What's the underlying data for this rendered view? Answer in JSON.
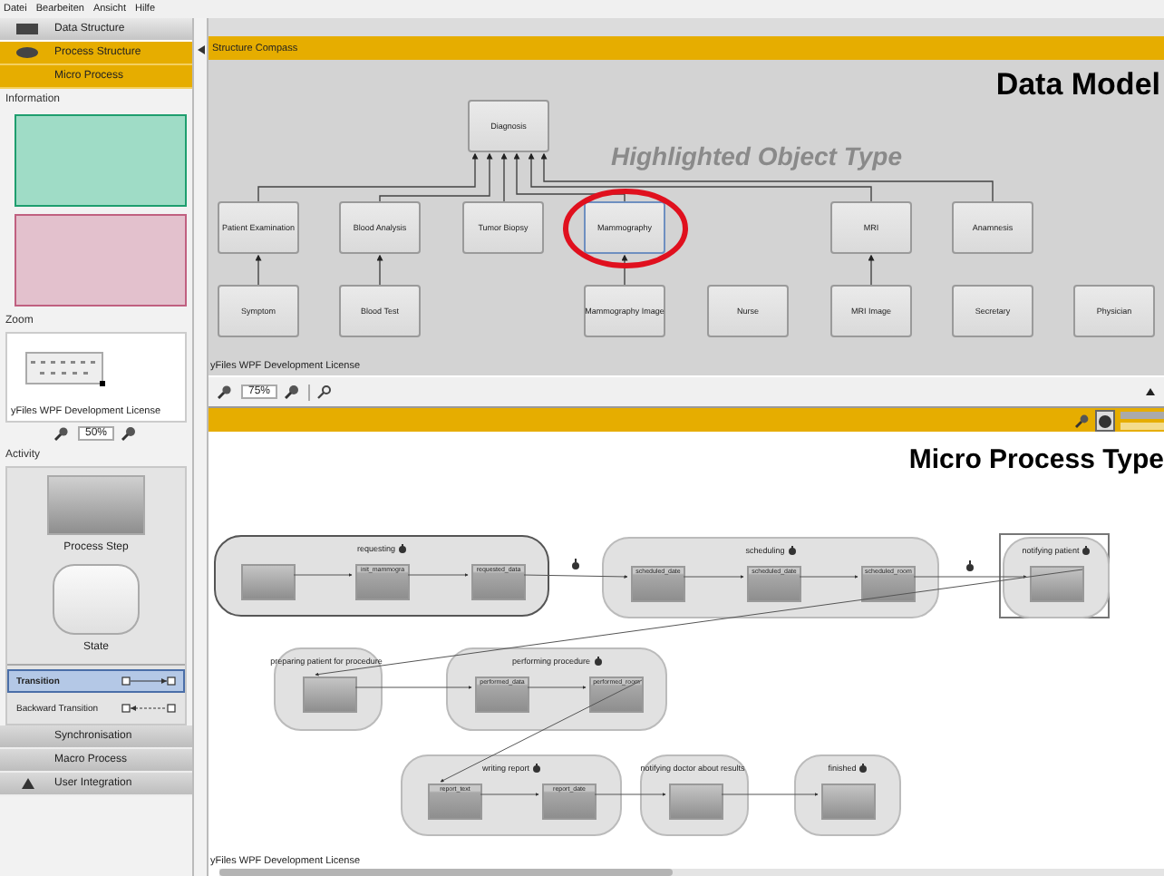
{
  "menu": [
    "Datei",
    "Bearbeiten",
    "Ansicht",
    "Hilfe"
  ],
  "navigation": [
    {
      "label": "Data Structure",
      "selected": false
    },
    {
      "label": "Process Structure",
      "selected": true
    },
    {
      "label": "Micro Process",
      "selected": true
    }
  ],
  "information": {
    "title": "Information",
    "cards": [
      {
        "color": "#9fdcc6"
      },
      {
        "color": "#e3c1cd"
      }
    ]
  },
  "zoom": {
    "title": "Zoom",
    "license": "yFiles WPF Development License",
    "value": "50%"
  },
  "activity": {
    "title": "Activity",
    "shapes": [
      {
        "kind": "process_step",
        "label": "Process Step"
      },
      {
        "kind": "state",
        "label": "State"
      }
    ],
    "transitions": [
      {
        "label": "Transition",
        "selected": true,
        "kind": "solid"
      },
      {
        "label": "Backward Transition",
        "selected": false,
        "kind": "dashed"
      }
    ]
  },
  "sections": [
    {
      "label": "Synchronisation"
    },
    {
      "label": "Macro Process"
    },
    {
      "label": "User Integration"
    }
  ],
  "structure_compass": {
    "title": "Structure Compass",
    "overlay_title": "Data Model",
    "annotation": "Highlighted Object Type",
    "license": "yFiles WPF Development License",
    "zoom_value": "75%",
    "root": {
      "label": "Diagnosis",
      "highlighted": false,
      "children": [
        {
          "label": "Patient Examination",
          "highlighted": false,
          "children": [
            {
              "label": "Symptom",
              "highlighted": false
            }
          ]
        },
        {
          "label": "Blood Analysis",
          "highlighted": false,
          "children": [
            {
              "label": "Blood Test",
              "highlighted": false
            }
          ]
        },
        {
          "label": "Tumor Biopsy",
          "highlighted": false
        },
        {
          "label": "Mammography",
          "highlighted": true,
          "children": [
            {
              "label": "Mammography Image",
              "highlighted": false
            }
          ]
        },
        {
          "label": "MRI",
          "highlighted": false,
          "children": [
            {
              "label": "MRI Image",
              "highlighted": false
            }
          ]
        },
        {
          "label": "Anamnesis",
          "highlighted": false
        }
      ]
    },
    "unlinked": [
      {
        "label": "Nurse",
        "highlighted": false
      },
      {
        "label": "Secretary",
        "highlighted": false
      },
      {
        "label": "Physician",
        "highlighted": false
      }
    ]
  },
  "micro_process": {
    "overlay_title": "Micro Process Type",
    "license": "yFiles WPF Development License",
    "states": [
      {
        "label": "requesting",
        "selected": true,
        "framed": false,
        "steps": [
          {
            "kind": "plain"
          },
          {
            "label": "init_mammogra"
          },
          {
            "label": "requested_data"
          }
        ]
      },
      {
        "label": "scheduling",
        "selected": false,
        "framed": false,
        "steps": [
          {
            "label": "scheduled_date"
          },
          {
            "label": "scheduled_date"
          },
          {
            "label": "scheduled_room"
          }
        ]
      },
      {
        "label": "notifying patient",
        "selected": false,
        "framed": true,
        "steps": [
          {
            "kind": "plain"
          }
        ]
      },
      {
        "label": "preparing patient for procedure",
        "selected": false,
        "framed": false,
        "steps": [
          {
            "kind": "plain"
          }
        ]
      },
      {
        "label": "performing procedure",
        "selected": false,
        "framed": false,
        "steps": [
          {
            "label": "performed_data"
          },
          {
            "label": "performed_room"
          }
        ]
      },
      {
        "label": "writing report",
        "selected": false,
        "framed": false,
        "steps": [
          {
            "label": "report_text"
          },
          {
            "label": "report_date"
          }
        ]
      },
      {
        "label": "notifying doctor about results",
        "selected": false,
        "framed": false,
        "steps": [
          {
            "kind": "plain"
          }
        ]
      },
      {
        "label": "finished",
        "selected": false,
        "framed": false,
        "steps": [
          {
            "kind": "plain"
          }
        ]
      }
    ]
  }
}
